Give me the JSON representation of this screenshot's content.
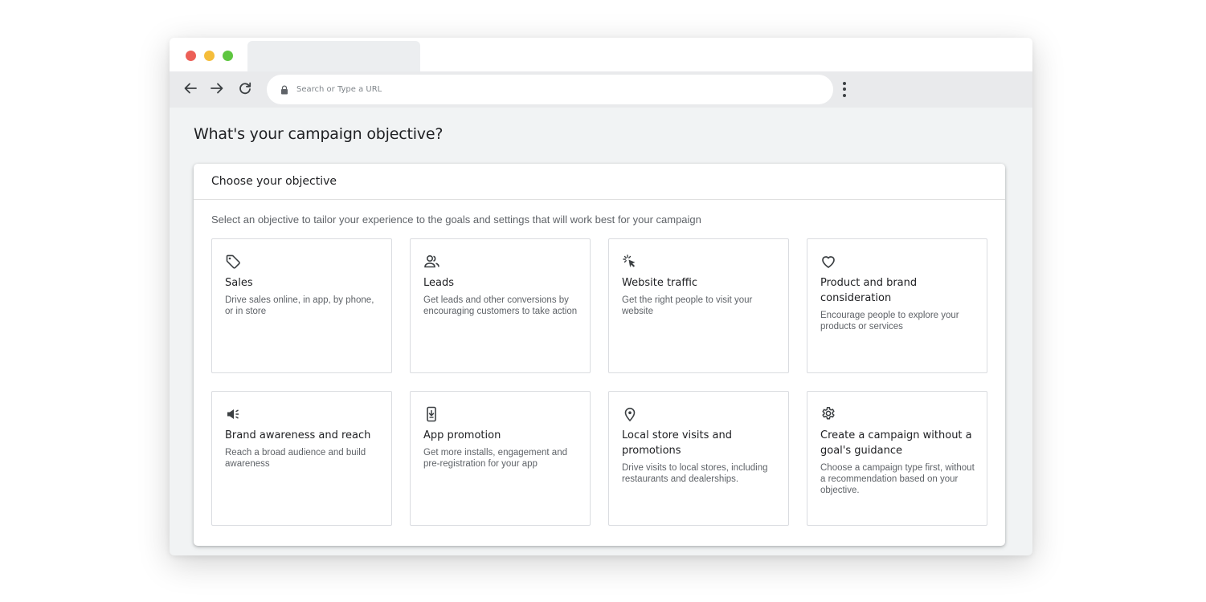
{
  "browser": {
    "url_placeholder": "Search or Type a URL"
  },
  "page": {
    "title": "What's your campaign objective?"
  },
  "card": {
    "header": "Choose your objective",
    "subtitle": "Select an objective to tailor your experience to the goals and settings that will work best for your campaign"
  },
  "objectives": [
    {
      "icon": "tag-icon",
      "title": "Sales",
      "description": "Drive sales online, in app, by phone, or in store"
    },
    {
      "icon": "people-icon",
      "title": "Leads",
      "description": "Get leads and other conversions by encouraging customers to take action"
    },
    {
      "icon": "cursor-click-icon",
      "title": "Website traffic",
      "description": "Get the right people to visit your website"
    },
    {
      "icon": "heart-icon",
      "title": "Product and brand consideration",
      "description": "Encourage people to explore your products or services"
    },
    {
      "icon": "megaphone-icon",
      "title": "Brand awareness and reach",
      "description": "Reach a broad audience and build awareness"
    },
    {
      "icon": "phone-download-icon",
      "title": "App promotion",
      "description": "Get more installs, engagement and pre-registration for your app"
    },
    {
      "icon": "location-pin-icon",
      "title": "Local store visits and promotions",
      "description": "Drive visits to local stores, including restaurants and dealerships."
    },
    {
      "icon": "gear-icon",
      "title": "Create a campaign without a goal's guidance",
      "description": "Choose a campaign type first, without a recommendation based on your objective."
    }
  ],
  "colors": {
    "traffic_red": "#ec5f57",
    "traffic_yellow": "#f5bd3a",
    "traffic_green": "#5ec640",
    "page_background": "#f1f3f4",
    "tile_border": "#dadce0"
  }
}
